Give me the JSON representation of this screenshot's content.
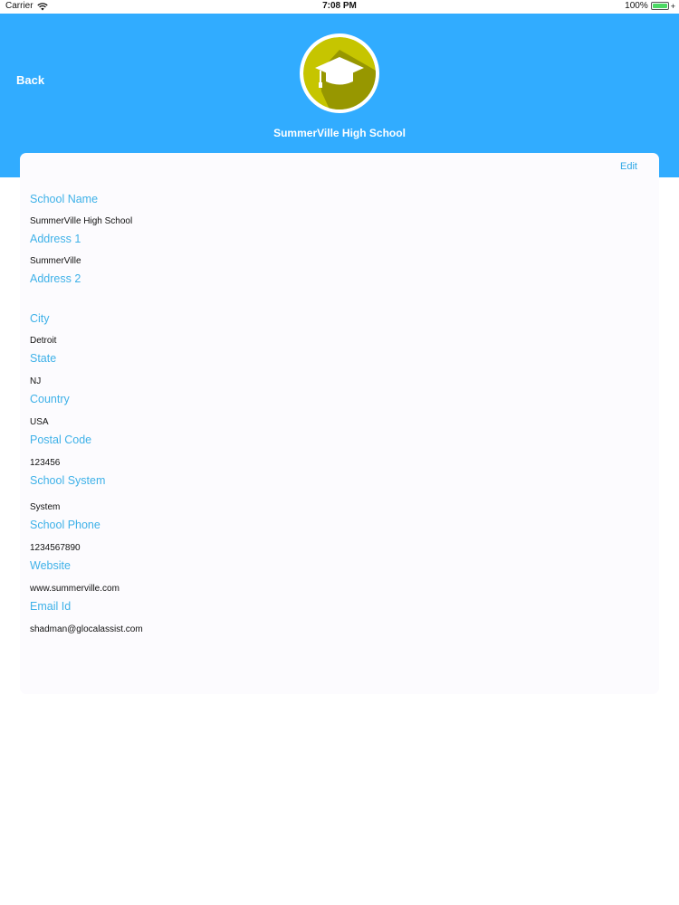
{
  "status_bar": {
    "carrier": "Carrier",
    "time": "7:08 PM",
    "battery": "100%"
  },
  "header": {
    "back_label": "Back",
    "title": "SummerVille High School",
    "logo_icon": "graduation-cap-icon",
    "logo_color": "#c6c500",
    "background_color": "#31acff"
  },
  "card": {
    "edit_label": "Edit",
    "fields": [
      {
        "label": "School Name",
        "value": "SummerVille High School"
      },
      {
        "label": "Address 1",
        "value": "SummerVille"
      },
      {
        "label": "Address 2",
        "value": ""
      },
      {
        "label": "City",
        "value": "Detroit"
      },
      {
        "label": "State",
        "value": "NJ"
      },
      {
        "label": "Country",
        "value": "USA"
      },
      {
        "label": "Postal Code",
        "value": "123456"
      },
      {
        "label": "School System",
        "value": "System"
      },
      {
        "label": "School Phone",
        "value": "1234567890"
      },
      {
        "label": "Website",
        "value": "www.summerville.com"
      },
      {
        "label": "Email Id",
        "value": "shadman@glocalassist.com"
      }
    ]
  }
}
